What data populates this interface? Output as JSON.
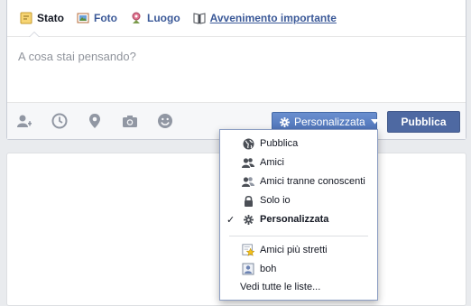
{
  "tabs": [
    {
      "label": "Stato",
      "icon": "status-icon"
    },
    {
      "label": "Foto",
      "icon": "photo-icon"
    },
    {
      "label": "Luogo",
      "icon": "place-icon"
    },
    {
      "label": "Avvenimento importante",
      "icon": "life-event-icon"
    }
  ],
  "composer": {
    "placeholder": "A cosa stai pensando?"
  },
  "toolbar": {
    "icons": [
      "tag-friends-icon",
      "clock-icon",
      "location-icon",
      "camera-icon",
      "emoticon-icon"
    ],
    "privacy_label": "Personalizzata",
    "publish_label": "Pubblica"
  },
  "privacy_menu": {
    "items": [
      {
        "label": "Pubblica",
        "icon": "globe-icon",
        "checked": false
      },
      {
        "label": "Amici",
        "icon": "friends-icon",
        "checked": false
      },
      {
        "label": "Amici tranne conoscenti",
        "icon": "friends-except-icon",
        "checked": false
      },
      {
        "label": "Solo io",
        "icon": "lock-icon",
        "checked": false
      },
      {
        "label": "Personalizzata",
        "icon": "gear-icon",
        "checked": true
      }
    ],
    "lists": [
      {
        "label": "Amici più stretti",
        "icon": "star-list-icon"
      },
      {
        "label": "boh",
        "icon": "list-icon"
      }
    ],
    "see_all": "Vedi tutte le liste..."
  },
  "colors": {
    "link": "#3b5998",
    "button": "#4e69a2",
    "privacy_button": "#5b7bc0"
  }
}
